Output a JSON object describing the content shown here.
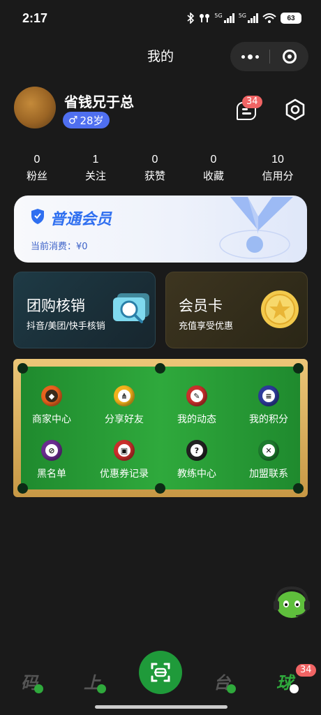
{
  "status_bar": {
    "time": "2:17",
    "net_a": "5G",
    "net_b": "5G",
    "battery": "63"
  },
  "title_bar": {
    "title": "我的"
  },
  "profile": {
    "username": "省钱兄于总",
    "gender_symbol": "♂",
    "age": "28岁",
    "message_badge": "34"
  },
  "stats": [
    {
      "value": "0",
      "label": "粉丝"
    },
    {
      "value": "1",
      "label": "关注"
    },
    {
      "value": "0",
      "label": "获赞"
    },
    {
      "value": "0",
      "label": "收藏"
    },
    {
      "value": "10",
      "label": "信用分"
    }
  ],
  "member": {
    "title": "普通会员",
    "spend": "当前消费：¥0"
  },
  "cards": {
    "group_buy": {
      "title": "团购核销",
      "subtitle": "抖音/美团/快手核销"
    },
    "vip": {
      "title": "会员卡",
      "subtitle": "充值享受优惠"
    }
  },
  "pool_menu": [
    {
      "label": "商家中心",
      "icon": "shop-icon",
      "color": "#e8621e"
    },
    {
      "label": "分享好友",
      "icon": "share-icon",
      "color": "#f2b21c"
    },
    {
      "label": "我的动态",
      "icon": "post-icon",
      "color": "#c9302c"
    },
    {
      "label": "我的积分",
      "icon": "points-icon",
      "color": "#2d3b9a"
    },
    {
      "label": "黑名单",
      "icon": "block-icon",
      "color": "#6a2d8f"
    },
    {
      "label": "优惠券记录",
      "icon": "coupon-icon",
      "color": "#c9302c"
    },
    {
      "label": "教练中心",
      "icon": "coach-icon",
      "color": "#222222"
    },
    {
      "label": "加盟联系",
      "icon": "join-icon",
      "color": "#1e7a2e"
    }
  ],
  "nav": [
    {
      "label": "码",
      "icon": "code-icon"
    },
    {
      "label": "上",
      "icon": "up-icon"
    },
    {
      "label": "台",
      "icon": "table-icon"
    },
    {
      "label": "球",
      "icon": "ball-icon"
    }
  ],
  "nav_badge": "34",
  "colors": {
    "accent_green": "#1f9a3a",
    "badge_red": "#f06464",
    "member_blue": "#2f6ff0"
  }
}
